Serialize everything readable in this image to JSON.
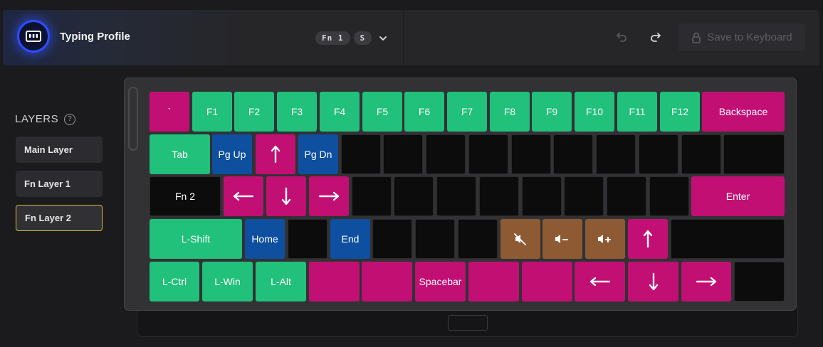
{
  "header": {
    "profile_title": "Typing Profile",
    "badges": [
      "Fn 1",
      "S"
    ],
    "save_label": "Save to Keyboard",
    "icons": {
      "logo": "keyboard-logo-icon",
      "dropdown": "chevron-down-icon",
      "undo": "undo-icon",
      "redo": "redo-icon",
      "lock": "lock-icon"
    }
  },
  "sidebar": {
    "title": "LAYERS",
    "help_icon": "?",
    "layers": [
      {
        "label": "Main Layer",
        "active": false
      },
      {
        "label": "Fn Layer 1",
        "active": false
      },
      {
        "label": "Fn Layer 2",
        "active": true
      }
    ]
  },
  "colors": {
    "pink": "#c20f74",
    "green": "#21c07b",
    "blue": "#0e4fa0",
    "brown": "#8e5a34",
    "dark": "#0c0c0d",
    "active_outline": "#d9b94a",
    "logo_glow": "#2e4cff"
  },
  "keyboard": {
    "row1": [
      "`",
      "F1",
      "F2",
      "F3",
      "F4",
      "F5",
      "F6",
      "F7",
      "F8",
      "F9",
      "F10",
      "F11",
      "F12",
      "Backspace"
    ],
    "row2": [
      "Tab",
      "Pg Up",
      "up-arrow-icon",
      "Pg Dn",
      "",
      "",
      "",
      "",
      "",
      "",
      "",
      "",
      "",
      ""
    ],
    "row3": [
      "Fn 2",
      "left-arrow-icon",
      "down-arrow-icon",
      "right-arrow-icon",
      "",
      "",
      "",
      "",
      "",
      "",
      "",
      "",
      "Enter"
    ],
    "row4": [
      "L-Shift",
      "Home",
      "",
      "End",
      "",
      "",
      "",
      "mute-icon",
      "volume-down-icon",
      "volume-up-icon",
      "up-arrow-icon",
      ""
    ],
    "row5": [
      "L-Ctrl",
      "L-Win",
      "L-Alt",
      "",
      "",
      "Spacebar",
      "",
      "",
      "left-arrow-icon",
      "down-arrow-icon",
      "right-arrow-icon",
      ""
    ]
  }
}
